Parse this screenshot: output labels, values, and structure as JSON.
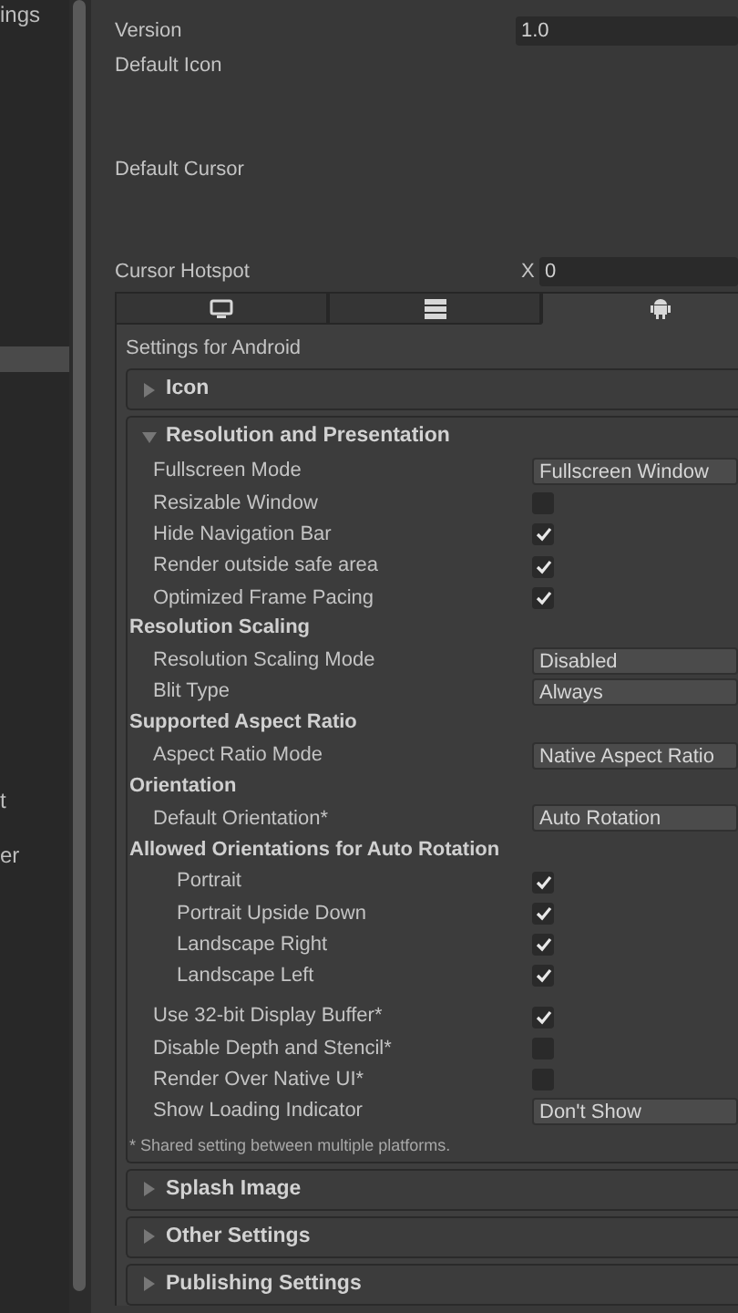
{
  "sidebar": {
    "items": [
      {
        "label": "ings",
        "selected": false
      },
      {
        "selected": true
      },
      {
        "label": "t",
        "selected": false
      },
      {
        "label": "er",
        "selected": false
      }
    ]
  },
  "fields": [
    {
      "kind": "text",
      "label": "Version",
      "value": "1.0"
    },
    {
      "kind": "image",
      "label": "Default Icon"
    },
    {
      "kind": "image",
      "label": "Default Cursor"
    },
    {
      "kind": "vector",
      "label": "Cursor Hotspot",
      "axis": "X",
      "value": "0"
    }
  ],
  "platform_tabs": [
    {
      "kind": "desktop",
      "selected": false
    },
    {
      "kind": "server",
      "selected": false
    },
    {
      "kind": "android",
      "selected": true
    }
  ],
  "platform_settings": {
    "title": "Settings for Android",
    "sections": [
      {
        "title": "Icon",
        "expanded": false
      },
      {
        "title": "Resolution and Presentation",
        "expanded": true,
        "rows": [
          {
            "kind": "dropdown",
            "label": "Fullscreen Mode",
            "value": "Fullscreen Window"
          },
          {
            "kind": "checkbox",
            "label": "Resizable Window",
            "checked": false
          },
          {
            "kind": "checkbox",
            "label": "Hide Navigation Bar",
            "checked": true
          },
          {
            "kind": "checkbox",
            "label": "Render outside safe area",
            "checked": true
          },
          {
            "kind": "checkbox",
            "label": "Optimized Frame Pacing",
            "checked": true
          },
          {
            "kind": "header",
            "label": "Resolution Scaling",
            "children": [
              {
                "kind": "dropdown",
                "label": "Resolution Scaling Mode",
                "value": "Disabled"
              },
              {
                "kind": "dropdown",
                "label": "Blit Type",
                "value": "Always"
              }
            ]
          },
          {
            "kind": "header",
            "label": "Supported Aspect Ratio",
            "children": [
              {
                "kind": "dropdown",
                "label": "Aspect Ratio Mode",
                "value": "Native Aspect Ratio"
              }
            ]
          },
          {
            "kind": "header",
            "label": "Orientation",
            "children": [
              {
                "kind": "dropdown",
                "label": "Default Orientation*",
                "value": "Auto Rotation"
              },
              {
                "kind": "header",
                "label": "Allowed Orientations for Auto Rotation",
                "children": [
                  {
                    "kind": "checkbox",
                    "label": "Portrait",
                    "checked": true
                  },
                  {
                    "kind": "checkbox",
                    "label": "Portrait Upside Down",
                    "checked": true
                  },
                  {
                    "kind": "checkbox",
                    "label": "Landscape Right",
                    "checked": true
                  },
                  {
                    "kind": "checkbox",
                    "label": "Landscape Left",
                    "checked": true
                  }
                ]
              }
            ]
          },
          {
            "kind": "spacer"
          },
          {
            "kind": "checkbox",
            "label": "Use 32-bit Display Buffer*",
            "checked": true
          },
          {
            "kind": "checkbox",
            "label": "Disable Depth and Stencil*",
            "checked": false
          },
          {
            "kind": "checkbox",
            "label": "Render Over Native UI*",
            "checked": false
          },
          {
            "kind": "dropdown",
            "label": "Show Loading Indicator",
            "value": "Don't Show"
          }
        ],
        "footnote": "* Shared setting between multiple platforms."
      },
      {
        "title": "Splash Image",
        "expanded": false
      },
      {
        "title": "Other Settings",
        "expanded": false
      },
      {
        "title": "Publishing Settings",
        "expanded": false
      }
    ]
  }
}
